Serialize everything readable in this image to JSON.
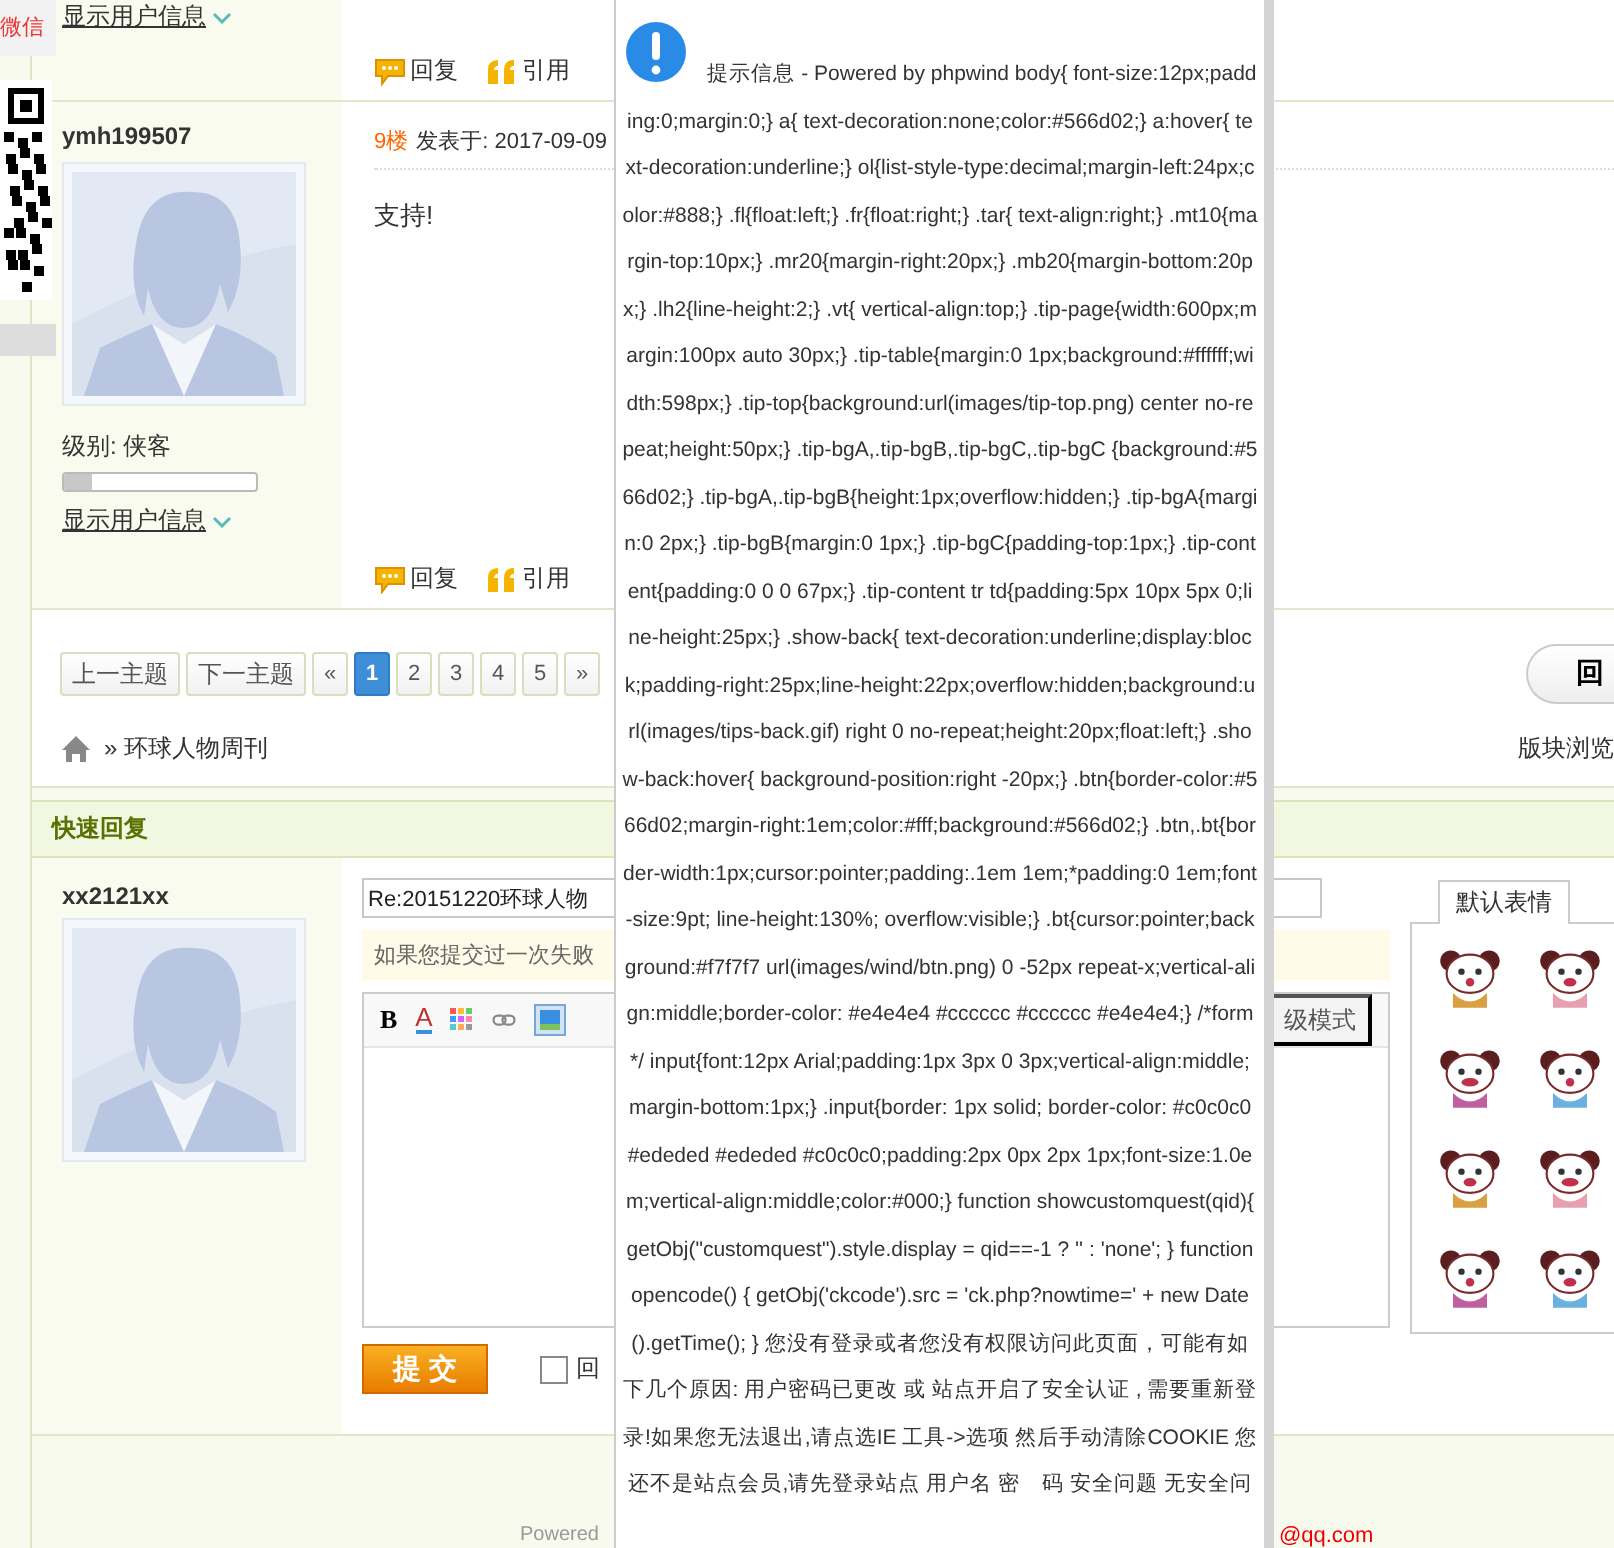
{
  "side_widget": {
    "label": "微信"
  },
  "previous_post": {
    "show_info": "显示用户信息",
    "actions": [
      {
        "kind": "reply",
        "label": "回复"
      },
      {
        "kind": "quote",
        "label": "引用"
      }
    ]
  },
  "post": {
    "username": "ymh199507",
    "level_label": "级别: 侠客",
    "level": 0.15,
    "show_info": "显示用户信息",
    "floor": "9楼",
    "posted": "发表于: 2017-09-09",
    "body": "支持!",
    "actions": [
      {
        "kind": "reply",
        "label": "回复"
      },
      {
        "kind": "quote",
        "label": "引用"
      }
    ]
  },
  "pagination": {
    "prev_topic": "上一主题",
    "next_topic": "下一主题",
    "first": "«",
    "pages": [
      {
        "label": "1",
        "selected": true
      },
      {
        "label": "2",
        "selected": false
      },
      {
        "label": "3",
        "selected": false
      },
      {
        "label": "4",
        "selected": false
      },
      {
        "label": "5",
        "selected": false
      }
    ],
    "last": "»",
    "round_button": "回"
  },
  "breadcrumb": {
    "trail": "» 环球人物周刊",
    "browse": "版块浏览"
  },
  "quick_reply": {
    "title": "快速回复",
    "username": "xx2121xx",
    "subject": "Re:20151220环球人物",
    "notice": "如果您提交过一次失败",
    "toolbar": [
      {
        "kind": "bold",
        "label": "B"
      },
      {
        "kind": "font_color",
        "label": "A"
      },
      {
        "kind": "palette"
      },
      {
        "kind": "link"
      },
      {
        "kind": "image"
      }
    ],
    "advanced_tab": "级模式",
    "submit": "提 交",
    "option": {
      "label": "回",
      "checked": false
    },
    "emoticon_tab": "默认表情"
  },
  "footer": {
    "powered": "Powered",
    "email": "@qq.com"
  },
  "popup": {
    "message": "提示信息 - Powered by phpwind body{ font-size:12px;padding:0;margin:0;} a{ text-decoration:none;color:#566d02;} a:hover{ text-decoration:underline;} ol{list-style-type:decimal;margin-left:24px;color:#888;} .fl{float:left;} .fr{float:right;} .tar{ text-align:right;} .mt10{margin-top:10px;} .mr20{margin-right:20px;} .mb20{margin-bottom:20px;} .lh2{line-height:2;} .vt{ vertical-align:top;} .tip-page{width:600px;margin:100px auto 30px;} .tip-table{margin:0 1px;background:#ffffff;width:598px;} .tip-top{background:url(images/tip-top.png) center no-repeat;height:50px;} .tip-bgA,.tip-bgB,.tip-bgC,.tip-bgC {background:#566d02;} .tip-bgA,.tip-bgB{height:1px;overflow:hidden;} .tip-bgA{margin:0 2px;} .tip-bgB{margin:0 1px;} .tip-bgC{padding-top:1px;} .tip-content{padding:0 0 0 67px;} .tip-content tr td{padding:5px 10px 5px 0;line-height:25px;} .show-back{ text-decoration:underline;display:block;padding-right:25px;line-height:22px;overflow:hidden;background:url(images/tips-back.gif) right 0 no-repeat;height:20px;float:left;} .show-back:hover{ background-position:right -20px;} .btn{border-color:#566d02;margin-right:1em;color:#fff;background:#566d02;} .btn,.bt{border-width:1px;cursor:pointer;padding:.1em 1em;*padding:0 1em;font-size:9pt; line-height:130%; overflow:visible;} .bt{cursor:pointer;background:#f7f7f7 url(images/wind/btn.png) 0 -52px repeat-x;vertical-align:middle;border-color: #e4e4e4 #cccccc #cccccc #e4e4e4;} /*form*/ input{font:12px Arial;padding:1px 3px 0 3px;vertical-align:middle;margin-bottom:1px;} .input{border: 1px solid; border-color: #c0c0c0 #ededed #ededed #c0c0c0;padding:2px 0px 2px 1px;font-size:1.0em;vertical-align:middle;color:#000;} function showcustomquest(qid){ getObj(\"customquest\").style.display = qid==-1 ? '' : 'none'; } function opencode() { getObj('ckcode').src = 'ck.php?nowtime=' + new Date().getTime(); } 您没有登录或者您没有权限访问此页面，可能有如下几个原因: 用户密码已更改 或 站点开启了安全认证 , 需要重新登录!如果您无法退出,请点选IE 工具->选项 然后手动清除COOKIE 您还不是站点会员,请先登录站点 用户名 密　码 安全问题 无安全问"
  }
}
